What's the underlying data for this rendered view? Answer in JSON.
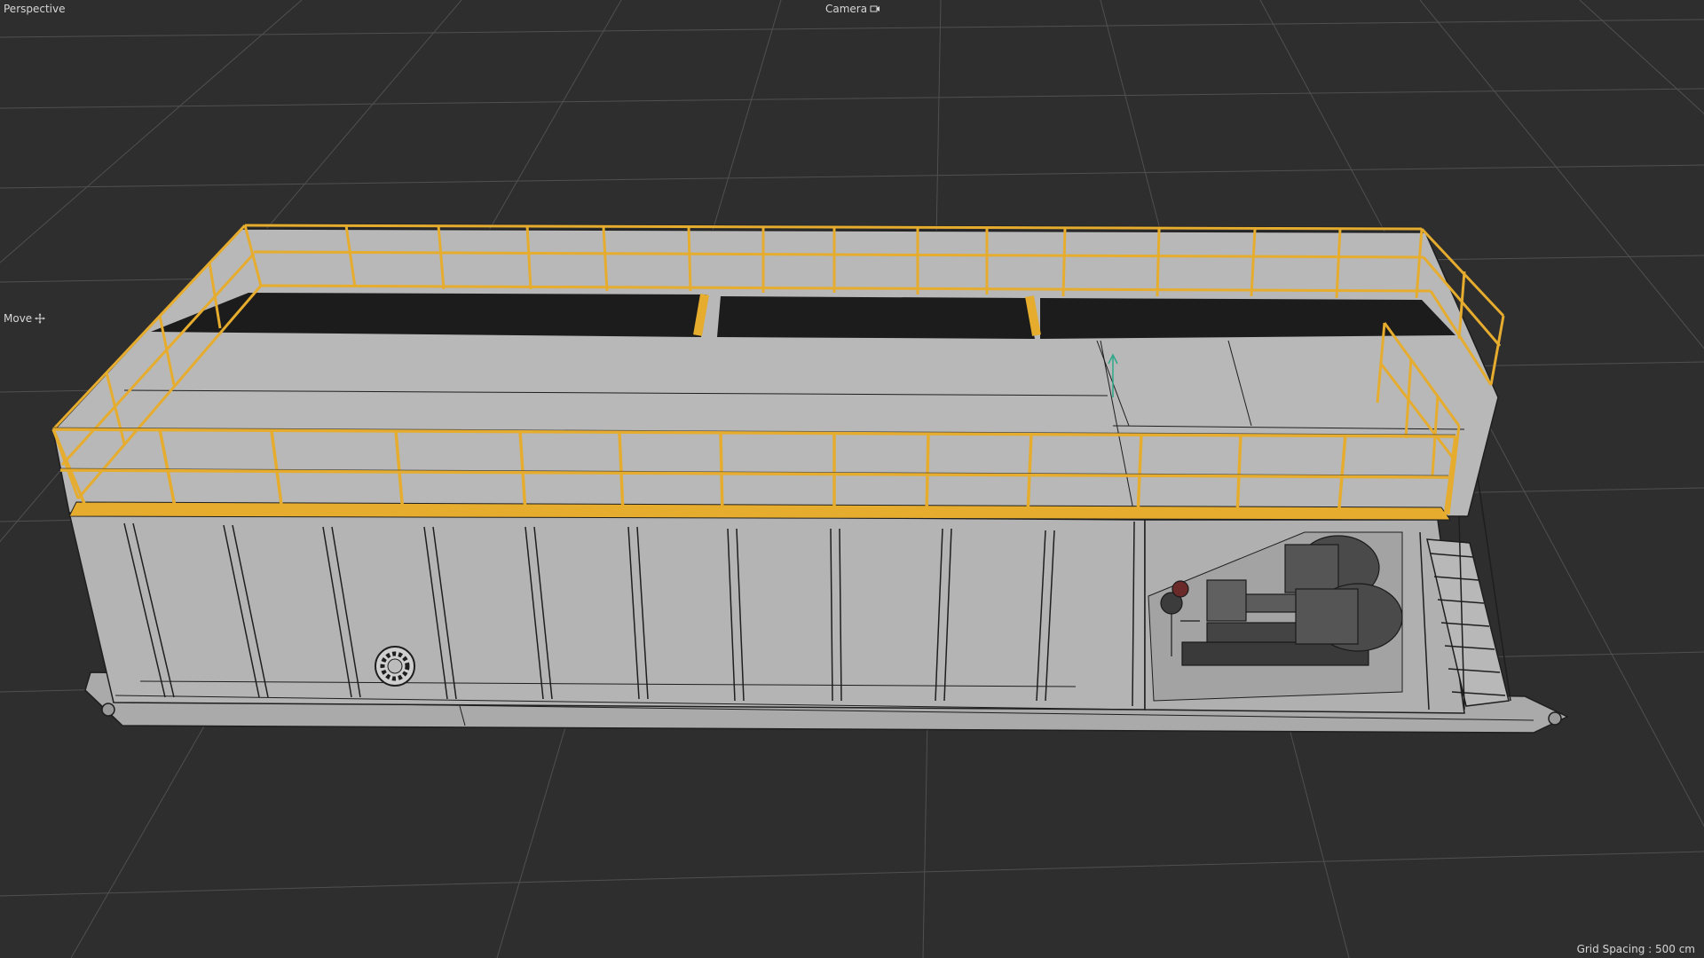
{
  "viewport": {
    "view_name": "Perspective",
    "camera_label": "Camera",
    "camera_icon": "camera-icon",
    "tool_label": "Move",
    "tool_icon": "move-icon",
    "grid_spacing": "Grid Spacing : 500 cm"
  },
  "colors": {
    "background": "#2e2e2e",
    "grid_line": "#505050",
    "model_fill": "#b4b4b4",
    "wireframe": "#1e1e1e",
    "selection_highlight": "#e6ac2e",
    "deck_opening": "#1c1c1c",
    "motor": "#484848",
    "axis_y": "#2fa88a",
    "hud_text": "#d6d6d6"
  }
}
